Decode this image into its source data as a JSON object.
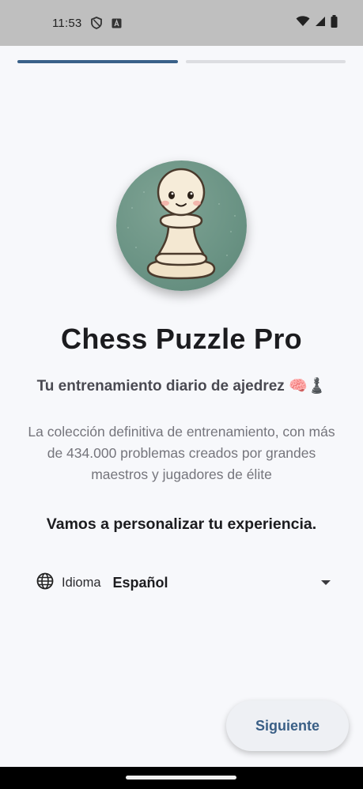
{
  "status_bar": {
    "time": "11:53",
    "icons": [
      "shield-icon",
      "a-box-icon",
      "wifi-icon",
      "signal-icon",
      "battery-icon"
    ]
  },
  "progress": {
    "steps": 2,
    "current": 1,
    "color_active": "#3a6189",
    "color_inactive": "#dcdde1"
  },
  "app": {
    "title": "Chess Puzzle Pro",
    "subtitle": "Tu entrenamiento diario de ajedrez 🧠♟️",
    "description": "La colección definitiva de entrenamiento, con más de 434.000 problemas creados por grandes maestros y jugadores de élite",
    "prompt": "Vamos a personalizar tu experiencia."
  },
  "language": {
    "label": "Idioma",
    "selected": "Español",
    "icon": "globe-icon"
  },
  "next_button": {
    "label": "Siguiente",
    "color": "#3a5f86"
  }
}
